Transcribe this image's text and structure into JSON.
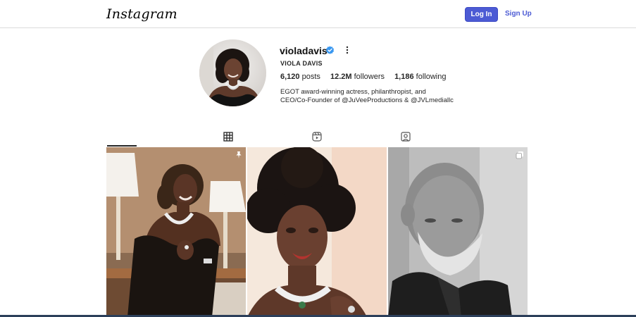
{
  "header": {
    "logo": "Instagram",
    "login_label": "Log In",
    "signup_label": "Sign Up"
  },
  "profile": {
    "username": "violadavis",
    "full_name": "VIOLA DAVIS",
    "verified": true,
    "stats": {
      "posts_value": "6,120",
      "posts_label": "posts",
      "followers_value": "12.2M",
      "followers_label": "followers",
      "following_value": "1,186",
      "following_label": "following"
    },
    "bio_line1": "EGOT award-winning actress, philanthropist, and",
    "bio_line2": "CEO/Co-Founder of @JuVeeProductions & @JVLmediallc"
  },
  "tabs": [
    {
      "name": "posts",
      "icon": "grid-icon",
      "active": true
    },
    {
      "name": "reels",
      "icon": "reels-icon",
      "active": false
    },
    {
      "name": "tagged",
      "icon": "tagged-icon",
      "active": false
    }
  ],
  "posts": [
    {
      "type": "photo",
      "badge": "pin-icon"
    },
    {
      "type": "photo",
      "badge": ""
    },
    {
      "type": "photo",
      "badge": "carousel-icon"
    }
  ],
  "colors": {
    "accent": "#4c5bd4",
    "verified": "#3897f0",
    "border": "#dbdbdb",
    "text": "#262626"
  }
}
